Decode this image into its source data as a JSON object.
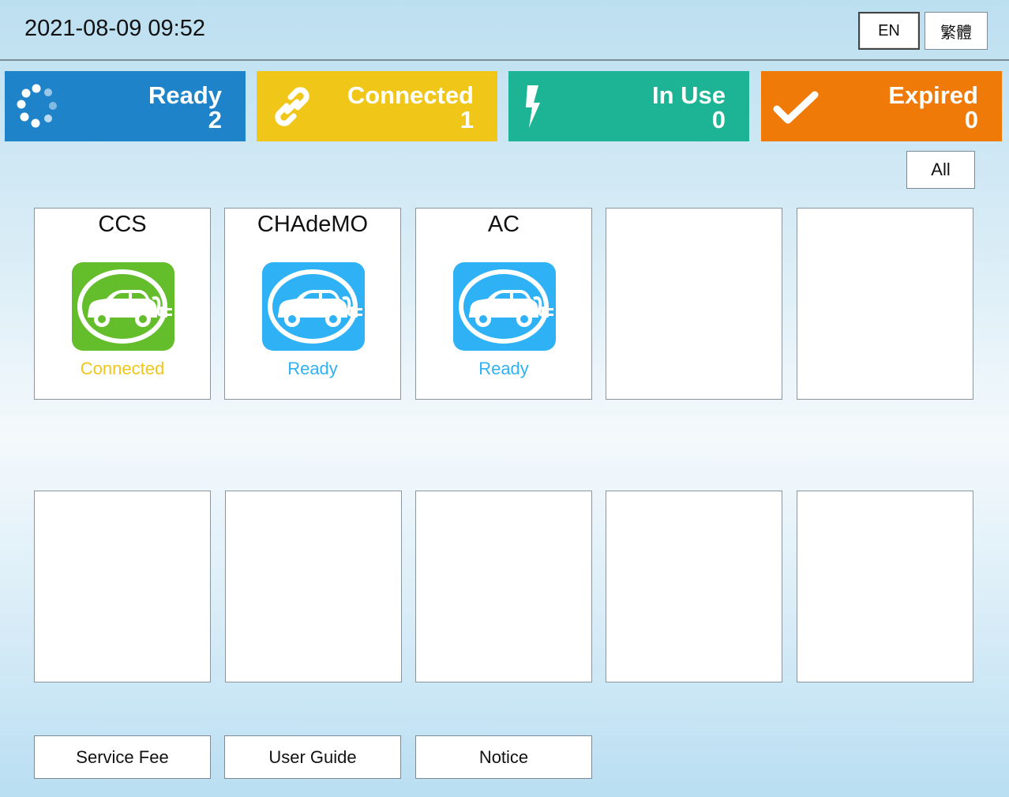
{
  "header": {
    "datetime": "2021-08-09 09:52"
  },
  "languages": [
    {
      "label": "EN",
      "active": true
    },
    {
      "label": "繁體",
      "active": false
    }
  ],
  "status_cards": [
    {
      "label": "Ready",
      "count": "2",
      "color": "#1f83c9",
      "icon": "loading-spinner-icon"
    },
    {
      "label": "Connected",
      "count": "1",
      "color": "#f0c619",
      "icon": "chain-link-icon"
    },
    {
      "label": "In Use",
      "count": "0",
      "color": "#1db496",
      "icon": "lightning-bolt-icon"
    },
    {
      "label": "Expired",
      "count": "0",
      "color": "#ef7a07",
      "icon": "checkmark-icon"
    }
  ],
  "filter": {
    "label": "All"
  },
  "chargers": [
    {
      "name": "CCS",
      "status": "Connected",
      "icon_color": "#64be2c",
      "status_color": "#f0c619",
      "icon": "ev-charging-icon"
    },
    {
      "name": "CHAdeMO",
      "status": "Ready",
      "icon_color": "#2fb1f5",
      "status_color": "#2fb1f5",
      "icon": "ev-charging-icon"
    },
    {
      "name": "AC",
      "status": "Ready",
      "icon_color": "#2fb1f5",
      "status_color": "#2fb1f5",
      "icon": "ev-charging-icon"
    }
  ],
  "footer": {
    "service_fee": "Service Fee",
    "user_guide": "User Guide",
    "notice": "Notice"
  }
}
